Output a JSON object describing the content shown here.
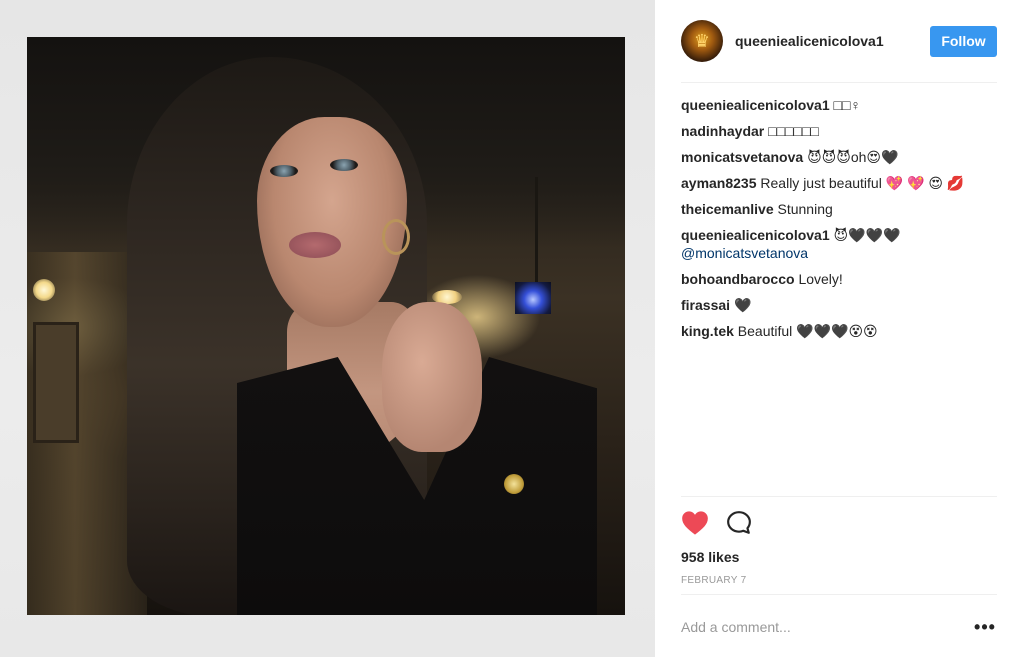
{
  "post": {
    "username": "queeniealicenicolova1",
    "follow_label": "Follow",
    "likes": "958 likes",
    "date": "FEBRUARY 7",
    "comment_placeholder": "Add a comment...",
    "more_label": "•••",
    "avatar_glyph": "♛"
  },
  "comments": [
    {
      "author": "queeniealicenicolova1",
      "text": "□□♀"
    },
    {
      "author": "nadinhaydar",
      "text": "□□□□□□"
    },
    {
      "author": "monicatsvetanova",
      "text": "😈😈😈oh😍🖤"
    },
    {
      "author": "ayman8235",
      "text": "Really just beautiful 💖 💖 😍 💋"
    },
    {
      "author": "theicemanlive",
      "text": "Stunning"
    },
    {
      "author": "queeniealicenicolova1",
      "text": "😈🖤🖤🖤",
      "mention": "@monicatsvetanova"
    },
    {
      "author": "bohoandbarocco",
      "text": "Lovely!"
    },
    {
      "author": "firassai",
      "text": "🖤"
    },
    {
      "author": "king.tek",
      "text": "Beautiful 🖤🖤🖤😵😵"
    }
  ],
  "icons": {
    "heart": "heart-icon",
    "comment": "comment-icon",
    "more": "more-options-icon",
    "avatar": "avatar-crown-icon"
  },
  "colors": {
    "follow_button": "#3897f0",
    "heart": "#ed4956",
    "text": "#262626",
    "muted": "#999999"
  }
}
